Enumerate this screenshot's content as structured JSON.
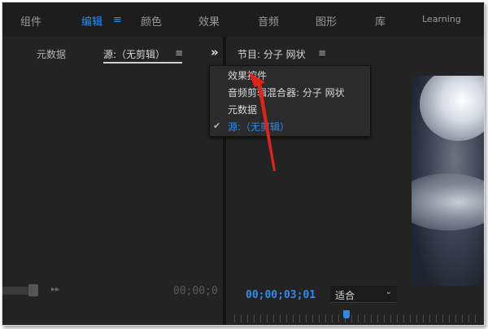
{
  "workspaces": {
    "tabs": [
      "组件",
      "编辑",
      "颜色",
      "效果",
      "音频",
      "图形",
      "库",
      "Learning"
    ],
    "active": "编辑",
    "menu_icon": "≡"
  },
  "left_panel": {
    "tabs": [
      "元数据",
      "源:（无剪辑）"
    ],
    "active_tab": "源:（无剪辑）",
    "menu_icon": "≡",
    "overflow_icon": "»",
    "timecode": "00;00;0",
    "step_icon": "▸▸"
  },
  "program_panel": {
    "title": "节目: 分子 网状",
    "menu_icon": "≡",
    "timecode": "00;00;03;01",
    "fit_value": "适合",
    "fit_chevron": "⌄"
  },
  "panel_menu": {
    "items": [
      "效果控件",
      "音频剪辑混合器: 分子 网状",
      "元数据",
      "源:（无剪辑）"
    ],
    "checked_item": "源:（无剪辑）",
    "check_icon": "✔"
  },
  "colors": {
    "accent": "#2d8ceb",
    "annotation_arrow": "#e0241c",
    "panel_bg": "#232323"
  },
  "icons": {
    "arrow": "red-arrow-annotation",
    "check": "check-icon",
    "menu": "hamburger-menu-icon",
    "overflow": "double-chevron-right-icon"
  }
}
